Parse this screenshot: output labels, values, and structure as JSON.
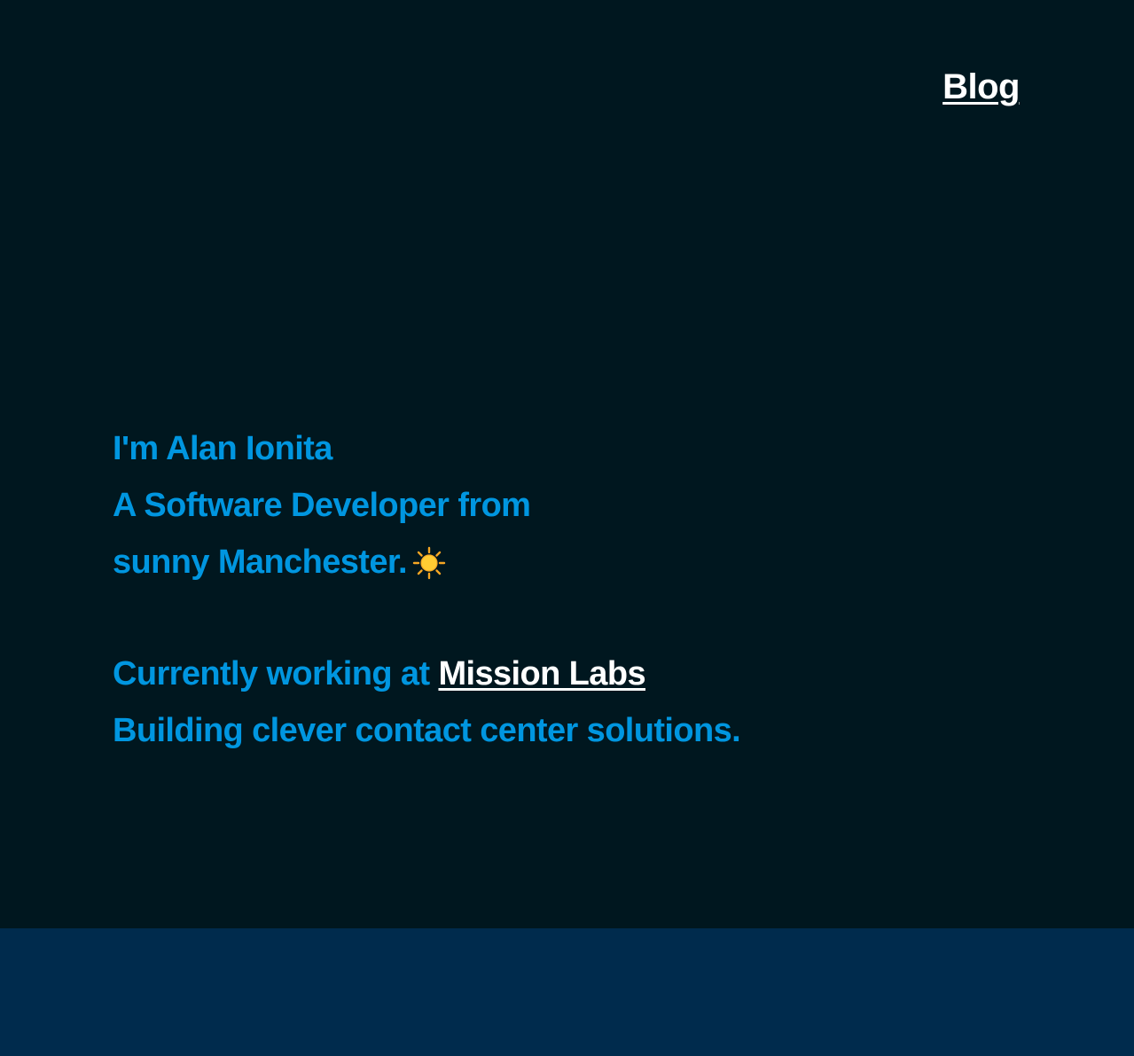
{
  "nav": {
    "blog_label": "Blog"
  },
  "intro": {
    "line1": "I'm Alan Ionita",
    "line2": "A Software Developer from",
    "line3": "sunny Manchester.",
    "line3_icon": "sun-icon",
    "line4_prefix": "Currently working at ",
    "line4_link": "Mission Labs",
    "line5": "Building clever contact center solutions."
  },
  "colors": {
    "background": "#00171f",
    "footer": "#002b4d",
    "accent": "#0096e0",
    "link": "#ffffff"
  }
}
